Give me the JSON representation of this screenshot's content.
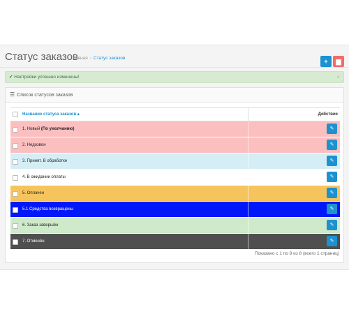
{
  "header": {
    "title": "Статус заказов",
    "breadcrumb": [
      "Главная",
      "Статус заказов"
    ],
    "add_icon": "plus-icon",
    "delete_icon": "trash-icon",
    "add_color": "#1e91cf",
    "delete_color": "#f56b6b"
  },
  "alert": {
    "icon": "check-circle-icon",
    "message": "Настройки успешно изменены!",
    "close": "×"
  },
  "panel": {
    "title": "Список статусов заказов",
    "icon": "list-icon"
  },
  "table": {
    "headers": {
      "name": "Название статуса заказов ▴",
      "action": "Действие"
    },
    "rows": [
      {
        "label": "1. Новый ",
        "bold": "(По умолчанию)",
        "bg": "#fcbfc0",
        "fg": "#222"
      },
      {
        "label": "2. Недозвон",
        "bold": "",
        "bg": "#fcbfc0",
        "fg": "#222"
      },
      {
        "label": "3. Принят. В обработке",
        "bold": "",
        "bg": "#d5eef6",
        "fg": "#222"
      },
      {
        "label": "4. В ожидании оплаты",
        "bold": "",
        "bg": "#ffffff",
        "fg": "#222"
      },
      {
        "label": "5. Оплачен",
        "bold": "",
        "bg": "#f6c45c",
        "fg": "#222"
      },
      {
        "label": "5.1 Средства возвращены",
        "bold": "",
        "bg": "#0018f9",
        "fg": "#ffffff"
      },
      {
        "label": "6. Заказ завершён",
        "bold": "",
        "bg": "#cfe9cb",
        "fg": "#222"
      },
      {
        "label": "7. Отменён",
        "bold": "",
        "bg": "#4f4f4f",
        "fg": "#ffffff"
      }
    ],
    "edit_icon": "pencil-icon"
  },
  "pagination": {
    "summary": "Показано с 1 по 8 из 8 (всего 1 страниц)"
  }
}
